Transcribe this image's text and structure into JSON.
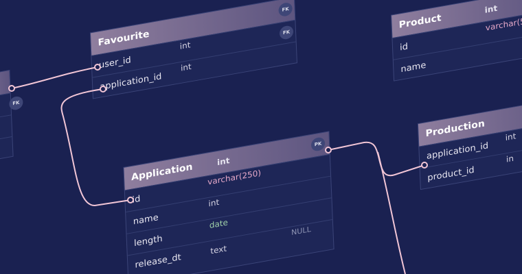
{
  "tables": {
    "favourite": {
      "title": "Favourite",
      "header_key": "FK",
      "rows": [
        {
          "name": "user_id",
          "type": "int",
          "key": "FK"
        },
        {
          "name": "application_id",
          "type": "int"
        }
      ]
    },
    "product": {
      "title": "Product",
      "header_type": "int",
      "rows": [
        {
          "name": "id",
          "type": "varchar(5"
        },
        {
          "name": "name",
          "type": ""
        }
      ]
    },
    "application": {
      "title": "Application",
      "header_type": "int",
      "key": "PK",
      "rows": [
        {
          "name": "id",
          "type": "varchar(250)"
        },
        {
          "name": "name",
          "type": "int"
        },
        {
          "name": "length",
          "type": "date"
        },
        {
          "name": "release_dt",
          "type": "text",
          "extra": "NULL"
        }
      ]
    },
    "production": {
      "title": "Production",
      "rows": [
        {
          "name": "application_id",
          "type": "int"
        },
        {
          "name": "product_id",
          "type": "in"
        }
      ]
    },
    "left_partial": {
      "key": "FK"
    }
  },
  "colors": {
    "background": "#1a2151",
    "header_start": "#8f7e9e",
    "header_end": "#5d5580",
    "connector": "#f2c6d6"
  }
}
